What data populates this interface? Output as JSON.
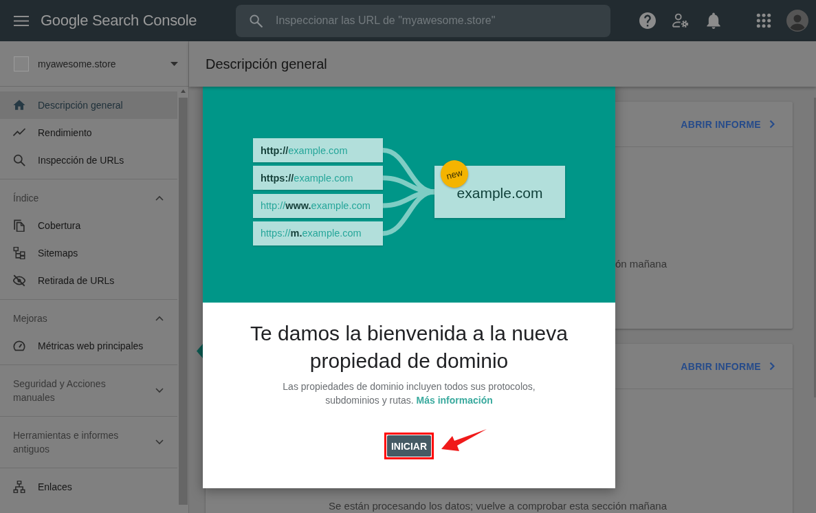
{
  "header": {
    "logo": "Google Search Console",
    "search": {
      "placeholder": "Inspeccionar las URL de \"myawesome.store\""
    }
  },
  "sidebar": {
    "property": "myawesome.store",
    "sections": [
      {
        "items": [
          {
            "label": "Descripción general",
            "selected": true
          },
          {
            "label": "Rendimiento",
            "selected": false
          },
          {
            "label": "Inspección de URLs",
            "selected": false
          }
        ]
      },
      {
        "title": "Índice",
        "expanded": true,
        "items": [
          {
            "label": "Cobertura",
            "selected": false
          },
          {
            "label": "Sitemaps",
            "selected": false
          },
          {
            "label": "Retirada de URLs",
            "selected": false
          }
        ]
      },
      {
        "title": "Mejoras",
        "expanded": true,
        "items": [
          {
            "label": "Métricas web principales",
            "selected": false
          }
        ]
      },
      {
        "title": "Seguridad y Acciones manuales",
        "expanded": false
      },
      {
        "title": "Herramientas e informes antiguos",
        "expanded": false
      },
      {
        "items": [
          {
            "label": "Enlaces",
            "selected": false
          }
        ]
      }
    ]
  },
  "main": {
    "title": "Descripción general",
    "cards": [
      {
        "link": "ABRIR INFORME",
        "message": "ón mañana"
      },
      {
        "link": "ABRIR INFORME",
        "message": "Se están procesando los datos; vuelve a comprobar esta sección mañana"
      }
    ]
  },
  "dialog": {
    "illustration": {
      "sources": [
        "**http://**example.com",
        "**https://**example.com",
        "http://**www.**example.com",
        "https://**m.**example.com"
      ],
      "target": "example.com",
      "badge": "new"
    },
    "title": "Te damos la bienvenida a la nueva propiedad de dominio",
    "description": "Las propiedades de dominio incluyen todos sus protocolos, subdominios y rutas.",
    "link": "Más información",
    "button": "INICIAR"
  }
}
